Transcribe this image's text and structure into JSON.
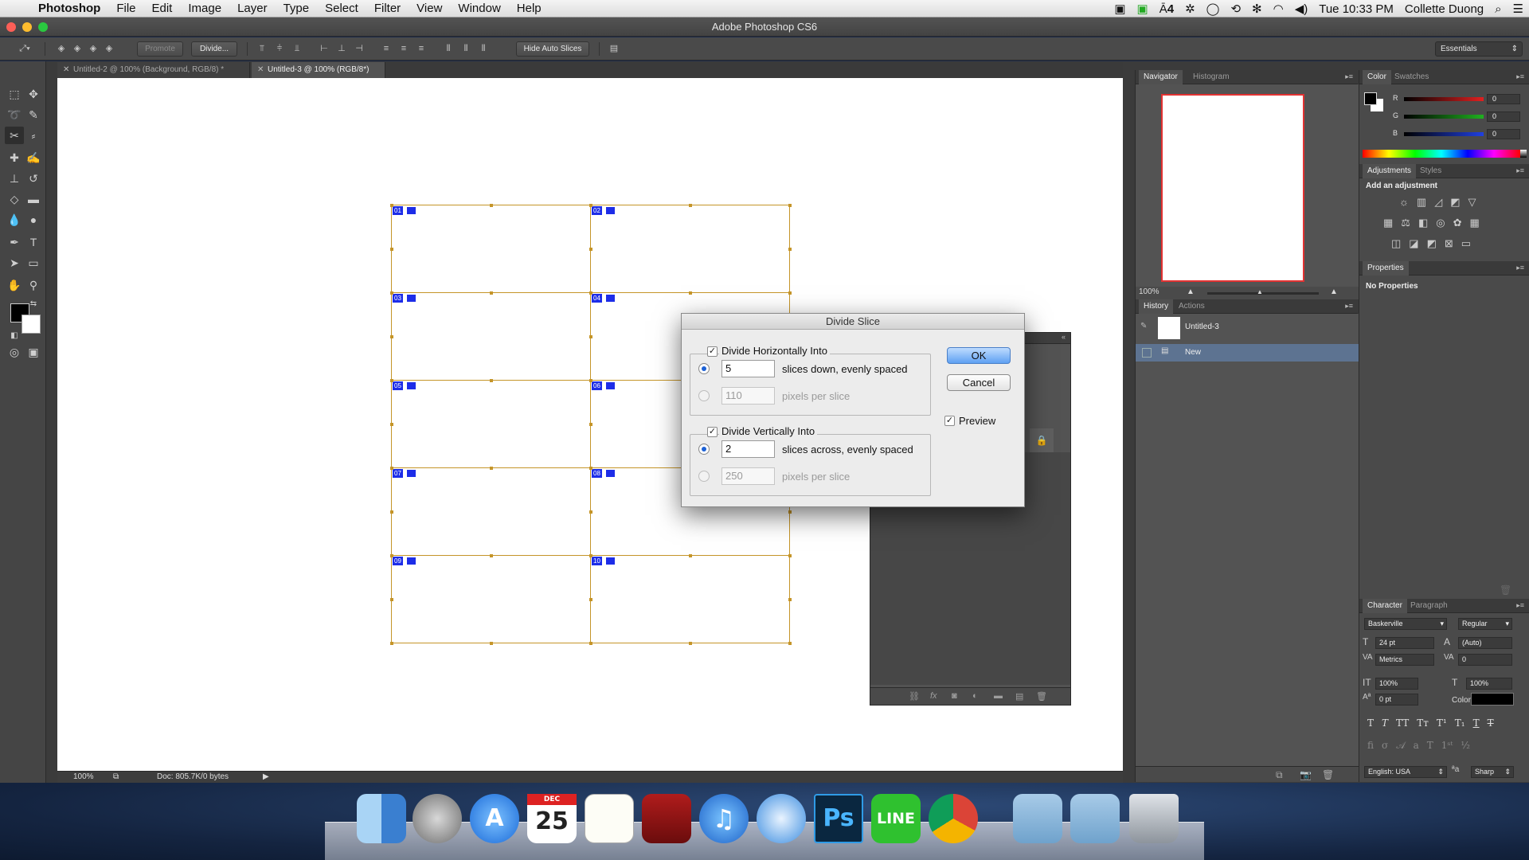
{
  "menubar": {
    "app_name": "Photoshop",
    "items": [
      "File",
      "Edit",
      "Image",
      "Layer",
      "Type",
      "Select",
      "Filter",
      "View",
      "Window",
      "Help"
    ],
    "status_badge": "4",
    "clock": "Tue 10:33 PM",
    "user": "Collette Duong"
  },
  "window": {
    "title": "Adobe Photoshop CS6"
  },
  "options_bar": {
    "promote": "Promote",
    "divide": "Divide...",
    "hide_auto_slices": "Hide Auto Slices",
    "workspace": "Essentials"
  },
  "tabs": [
    {
      "label": "Untitled-2 @ 100% (Background, RGB/8) *"
    },
    {
      "label": "Untitled-3 @ 100% (RGB/8*)"
    }
  ],
  "slices": [
    "01",
    "02",
    "03",
    "04",
    "05",
    "06",
    "07",
    "08",
    "09",
    "10"
  ],
  "statusbar": {
    "zoom": "100%",
    "doc": "Doc: 805.7K/0 bytes"
  },
  "navigator": {
    "tabs": [
      "Navigator",
      "Histogram"
    ],
    "zoom": "100%"
  },
  "history": {
    "tabs": [
      "History",
      "Actions"
    ],
    "items": [
      {
        "label": "Untitled-3"
      },
      {
        "label": "New"
      }
    ]
  },
  "color": {
    "tabs": [
      "Color",
      "Swatches"
    ],
    "channels": [
      {
        "name": "R",
        "value": "0",
        "color": "#e02020"
      },
      {
        "name": "G",
        "value": "0",
        "color": "#20b020"
      },
      {
        "name": "B",
        "value": "0",
        "color": "#2040e0"
      }
    ]
  },
  "adjustments": {
    "tabs": [
      "Adjustments",
      "Styles"
    ],
    "add_label": "Add an adjustment"
  },
  "properties": {
    "title": "Properties",
    "empty": "No Properties"
  },
  "character": {
    "tabs": [
      "Character",
      "Paragraph"
    ],
    "font_family": "Baskerville",
    "font_style": "Regular",
    "size": "24 pt",
    "leading": "(Auto)",
    "kerning": "Metrics",
    "tracking": "0",
    "vscale": "100%",
    "hscale": "100%",
    "baseline": "0 pt",
    "color_label": "Color:",
    "language": "English: USA",
    "antialias": "Sharp"
  },
  "dialog": {
    "title": "Divide Slice",
    "horiz_label": "Divide Horizontally Into",
    "horiz_slices": "5",
    "horiz_slices_text": "slices down, evenly spaced",
    "horiz_pixels": "110",
    "horiz_pixels_text": "pixels per slice",
    "vert_label": "Divide Vertically Into",
    "vert_slices": "2",
    "vert_slices_text": "slices across, evenly spaced",
    "vert_pixels": "250",
    "vert_pixels_text": "pixels per slice",
    "ok": "OK",
    "cancel": "Cancel",
    "preview": "Preview"
  },
  "dock": [
    {
      "name": "finder",
      "label": ""
    },
    {
      "name": "launchpad",
      "label": ""
    },
    {
      "name": "app-store",
      "label": "A"
    },
    {
      "name": "calendar",
      "label": "25"
    },
    {
      "name": "reminders",
      "label": ""
    },
    {
      "name": "photo-booth",
      "label": ""
    },
    {
      "name": "itunes",
      "label": "♫"
    },
    {
      "name": "safari",
      "label": ""
    },
    {
      "name": "photoshop",
      "label": "Ps"
    },
    {
      "name": "line",
      "label": "LINE"
    },
    {
      "name": "chrome",
      "label": ""
    },
    {
      "name": "downloads",
      "label": ""
    },
    {
      "name": "applications",
      "label": ""
    },
    {
      "name": "trash",
      "label": ""
    }
  ],
  "dock_calendar_month": "DEC"
}
